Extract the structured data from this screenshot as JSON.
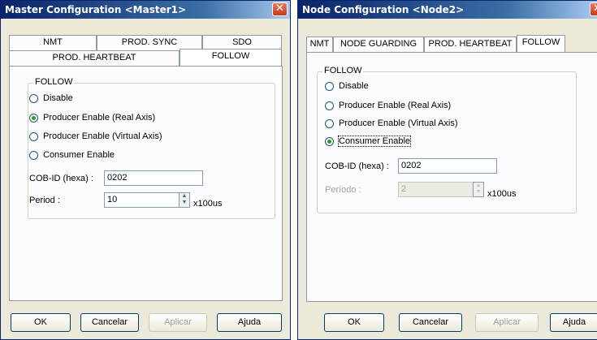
{
  "left_dialog": {
    "title": "Master Configuration <Master1>",
    "tabs_row1": [
      "NMT",
      "PROD. SYNC",
      "SDO"
    ],
    "tabs_row2": [
      "PROD. HEARTBEAT",
      "FOLLOW"
    ],
    "group_title": "FOLLOW",
    "radios": [
      {
        "label": "Disable",
        "checked": false
      },
      {
        "label": "Producer Enable (Real Axis)",
        "checked": true
      },
      {
        "label": "Producer Enable (Virtual Axis)",
        "checked": false
      },
      {
        "label": "Consumer Enable",
        "checked": false
      }
    ],
    "cobid_label": "COB-ID (hexa) :",
    "cobid_value": "0202",
    "period_label": "Period :",
    "period_value": "10",
    "period_unit": "x100us",
    "buttons": {
      "ok": "OK",
      "cancel": "Cancelar",
      "apply": "Aplicar",
      "help": "Ajuda"
    }
  },
  "right_dialog": {
    "title": "Node Configuration <Node2>",
    "tabs": [
      "NMT",
      "NODE GUARDING",
      "PROD. HEARTBEAT",
      "FOLLOW"
    ],
    "group_title": "FOLLOW",
    "radios": [
      {
        "label": "Disable",
        "checked": false
      },
      {
        "label": "Producer Enable (Real Axis)",
        "checked": false
      },
      {
        "label": "Producer Enable (Virtual Axis)",
        "checked": false
      },
      {
        "label": "Consumer Enable",
        "checked": true
      }
    ],
    "cobid_label": "COB-ID (hexa) :",
    "cobid_value": "0202",
    "period_label": "Período :",
    "period_value": "2",
    "period_unit": "x100us",
    "buttons": {
      "ok": "OK",
      "cancel": "Cancelar",
      "apply": "Aplicar",
      "help": "Ajuda"
    }
  }
}
